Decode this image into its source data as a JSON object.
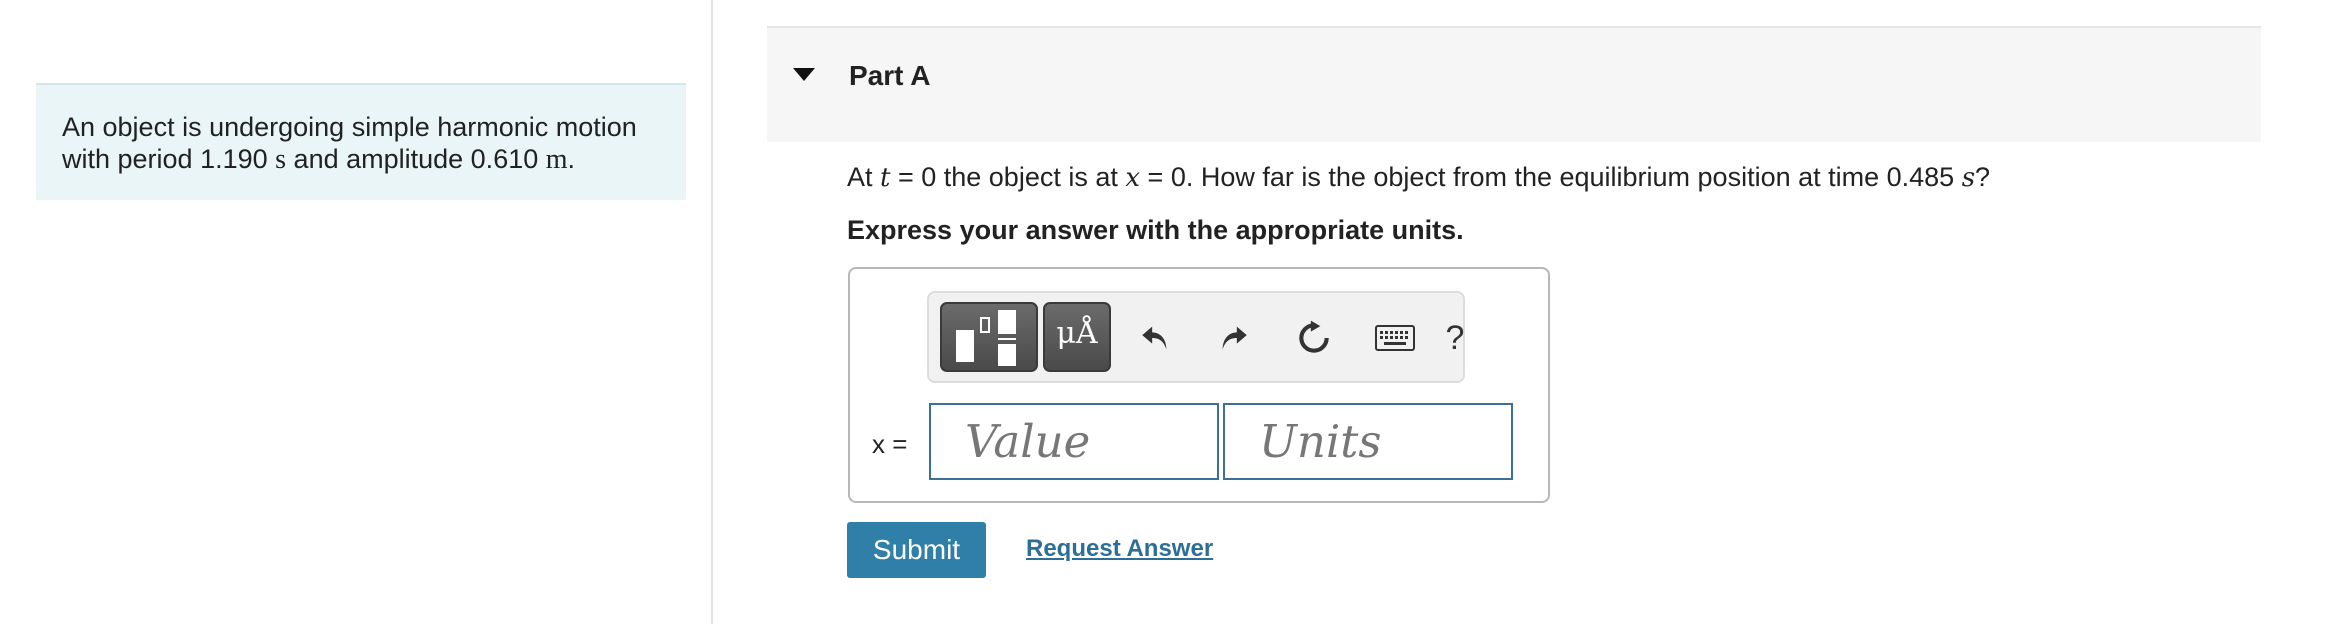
{
  "problem": {
    "text_1": "An object is undergoing simple harmonic motion",
    "text_2": "with period 1.190 ",
    "period_unit": "s",
    "text_3": " and amplitude 0.610 ",
    "amplitude_unit": "m",
    "text_4": "."
  },
  "part": {
    "title": "Part A"
  },
  "question": {
    "pre_1": "At ",
    "var_t": "t",
    "mid_1": " = 0 the object is at ",
    "var_x": "x",
    "mid_2": " = 0. How far is the object from the equilibrium position at time 0.485 ",
    "unit_s": "s",
    "end": "?"
  },
  "instruction": "Express your answer with the appropriate units.",
  "toolbar": {
    "units_label": "μÅ",
    "help_label": "?"
  },
  "answer": {
    "var_label": "x =",
    "value_placeholder": "Value",
    "units_placeholder": "Units"
  },
  "actions": {
    "submit_label": "Submit",
    "request_label": "Request Answer"
  },
  "colors": {
    "accent": "#2f7fa8",
    "panel_bg": "#e9f5f6",
    "field_border": "#3f6f98"
  }
}
